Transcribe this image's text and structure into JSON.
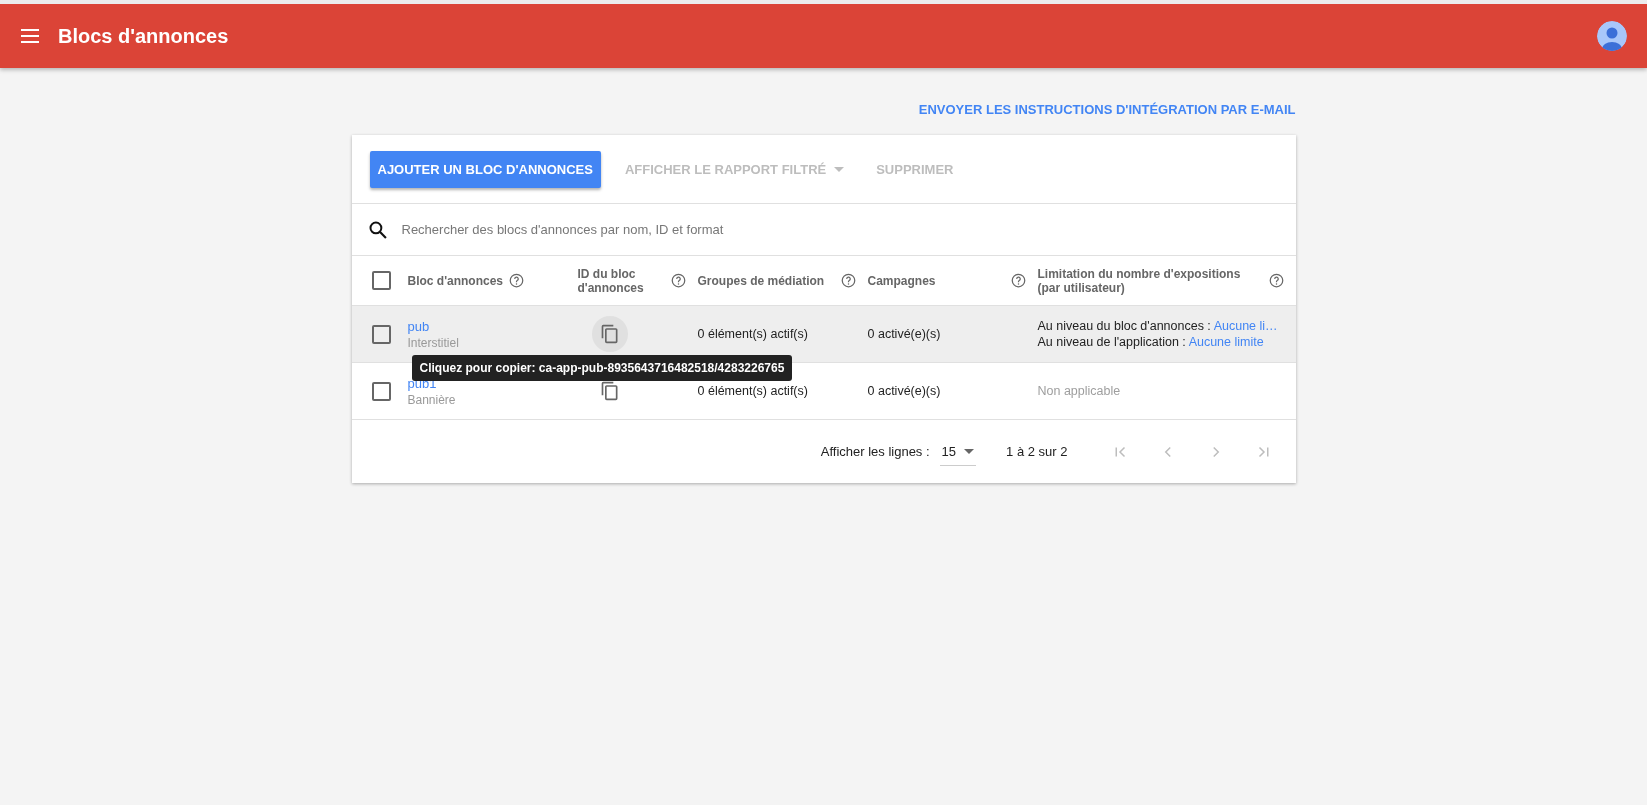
{
  "app_bar": {
    "title": "Blocs d'annonces"
  },
  "email_link": "ENVOYER LES INSTRUCTIONS D'INTÉGRATION PAR E-MAIL",
  "toolbar": [
    {
      "label": "AJOUTER UN BLOC D'ANNONCES",
      "kind": "primary",
      "disabled": false
    },
    {
      "label": "AFFICHER LE RAPPORT FILTRÉ",
      "kind": "dropdown",
      "disabled": true
    },
    {
      "label": "SUPPRIMER",
      "kind": "plain",
      "disabled": true
    }
  ],
  "search": {
    "placeholder": "Rechercher des blocs d'annonces par nom, ID et format"
  },
  "table": {
    "select_all": {
      "checked": false
    },
    "columns": [
      {
        "label": "Bloc d'annonces"
      },
      {
        "label": "ID du bloc d'annonces"
      },
      {
        "label": "Groupes de médiation"
      },
      {
        "label": "Campagnes"
      },
      {
        "label": "Limitation du nombre d'expositions (par utilisateur)"
      }
    ],
    "rows": [
      {
        "name": "pub",
        "format": "Interstitiel",
        "checked": false,
        "hovered": true,
        "mediation": "0 élément(s) actif(s)",
        "campaigns": "0 activé(e)(s)",
        "capping": [
          {
            "prefix": "Au niveau du bloc d'annonces :",
            "value": "Aucune li…"
          },
          {
            "prefix": "Au niveau de l'application :",
            "value": "Aucune limite"
          }
        ],
        "tooltip": "Cliquez pour copier: ca-app-pub-8935643716482518/4283226765"
      },
      {
        "name": "pub1",
        "format": "Bannière",
        "checked": false,
        "hovered": false,
        "mediation": "0 élément(s) actif(s)",
        "campaigns": "0 activé(e)(s)",
        "capping_note": "Non applicable"
      }
    ]
  },
  "pagination": {
    "label": "Afficher les lignes :",
    "rows_per_page": "15",
    "range": "1 à 2 sur 2",
    "buttons": [
      {
        "kind": "first",
        "disabled": true
      },
      {
        "kind": "prev",
        "disabled": true
      },
      {
        "kind": "next",
        "disabled": true
      },
      {
        "kind": "last",
        "disabled": true
      }
    ]
  }
}
